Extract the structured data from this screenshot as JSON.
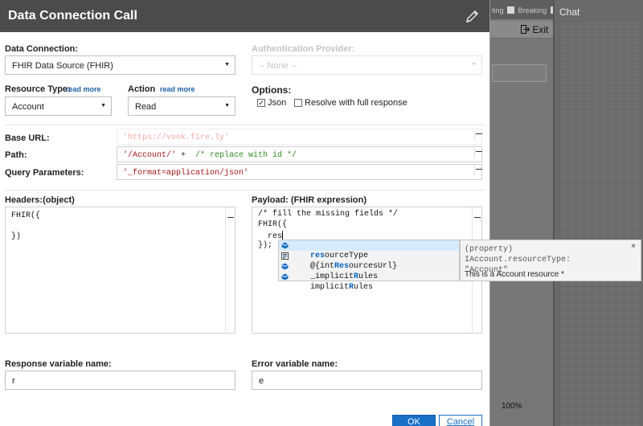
{
  "background": {
    "toggles": [
      "ting",
      "Breaking"
    ],
    "exit_label": "Exit",
    "zoom": "100%",
    "chat_title": "Chat"
  },
  "dialog": {
    "title": "Data Connection Call",
    "data_connection": {
      "label": "Data Connection:",
      "value": "FHIR Data Source (FHIR)"
    },
    "auth_provider": {
      "label": "Authentication Provider:",
      "value": "-- None --"
    },
    "resource_type": {
      "label": "Resource Type:",
      "read_more": "read more",
      "value": "Account"
    },
    "action": {
      "label": "Action",
      "read_more": "read more",
      "value": "Read"
    },
    "options": {
      "label": "Options:",
      "json_label": "Json",
      "json_checked": true,
      "full_response_label": "Resolve with full response",
      "full_response_checked": false
    },
    "base_url": {
      "label": "Base URL:",
      "value": "'https://vonk.fire.ly'"
    },
    "path": {
      "label": "Path:",
      "string_part": "'/Account/'",
      "operator": " +  ",
      "comment": "/* replace with id */"
    },
    "query": {
      "label": "Query Parameters:",
      "value": "'_format=application/json'"
    },
    "headers": {
      "label": "Headers:(object)",
      "lines": [
        "FHIR({",
        "",
        "})"
      ]
    },
    "payload": {
      "label": "Payload: (FHIR expression)",
      "comment": "/* fill the missing fields */",
      "line2": "FHIR({",
      "line3": "  res",
      "line4": "});"
    },
    "autocomplete": {
      "items": [
        {
          "prefix": "",
          "match": "res",
          "rest": "ourceType",
          "icon": "field-icon"
        },
        {
          "prefix": "@{int",
          "match": "Res",
          "rest": "ourcesUrl}",
          "icon": "snippet-icon"
        },
        {
          "prefix": "_implicit",
          "match": "R",
          "rest": "ules",
          "icon": "field-icon"
        },
        {
          "prefix": "implicit",
          "match": "R",
          "rest": "ules",
          "icon": "field-icon"
        }
      ],
      "signature": "(property) IAccount.resourceType: \"Account\"",
      "doc": "This is a Account resource *",
      "close": "×"
    },
    "response_var": {
      "label": "Response variable name:",
      "value": "r"
    },
    "error_var": {
      "label": "Error variable name:",
      "value": "e"
    },
    "ok_label": "OK",
    "cancel_label": "Cancel"
  }
}
